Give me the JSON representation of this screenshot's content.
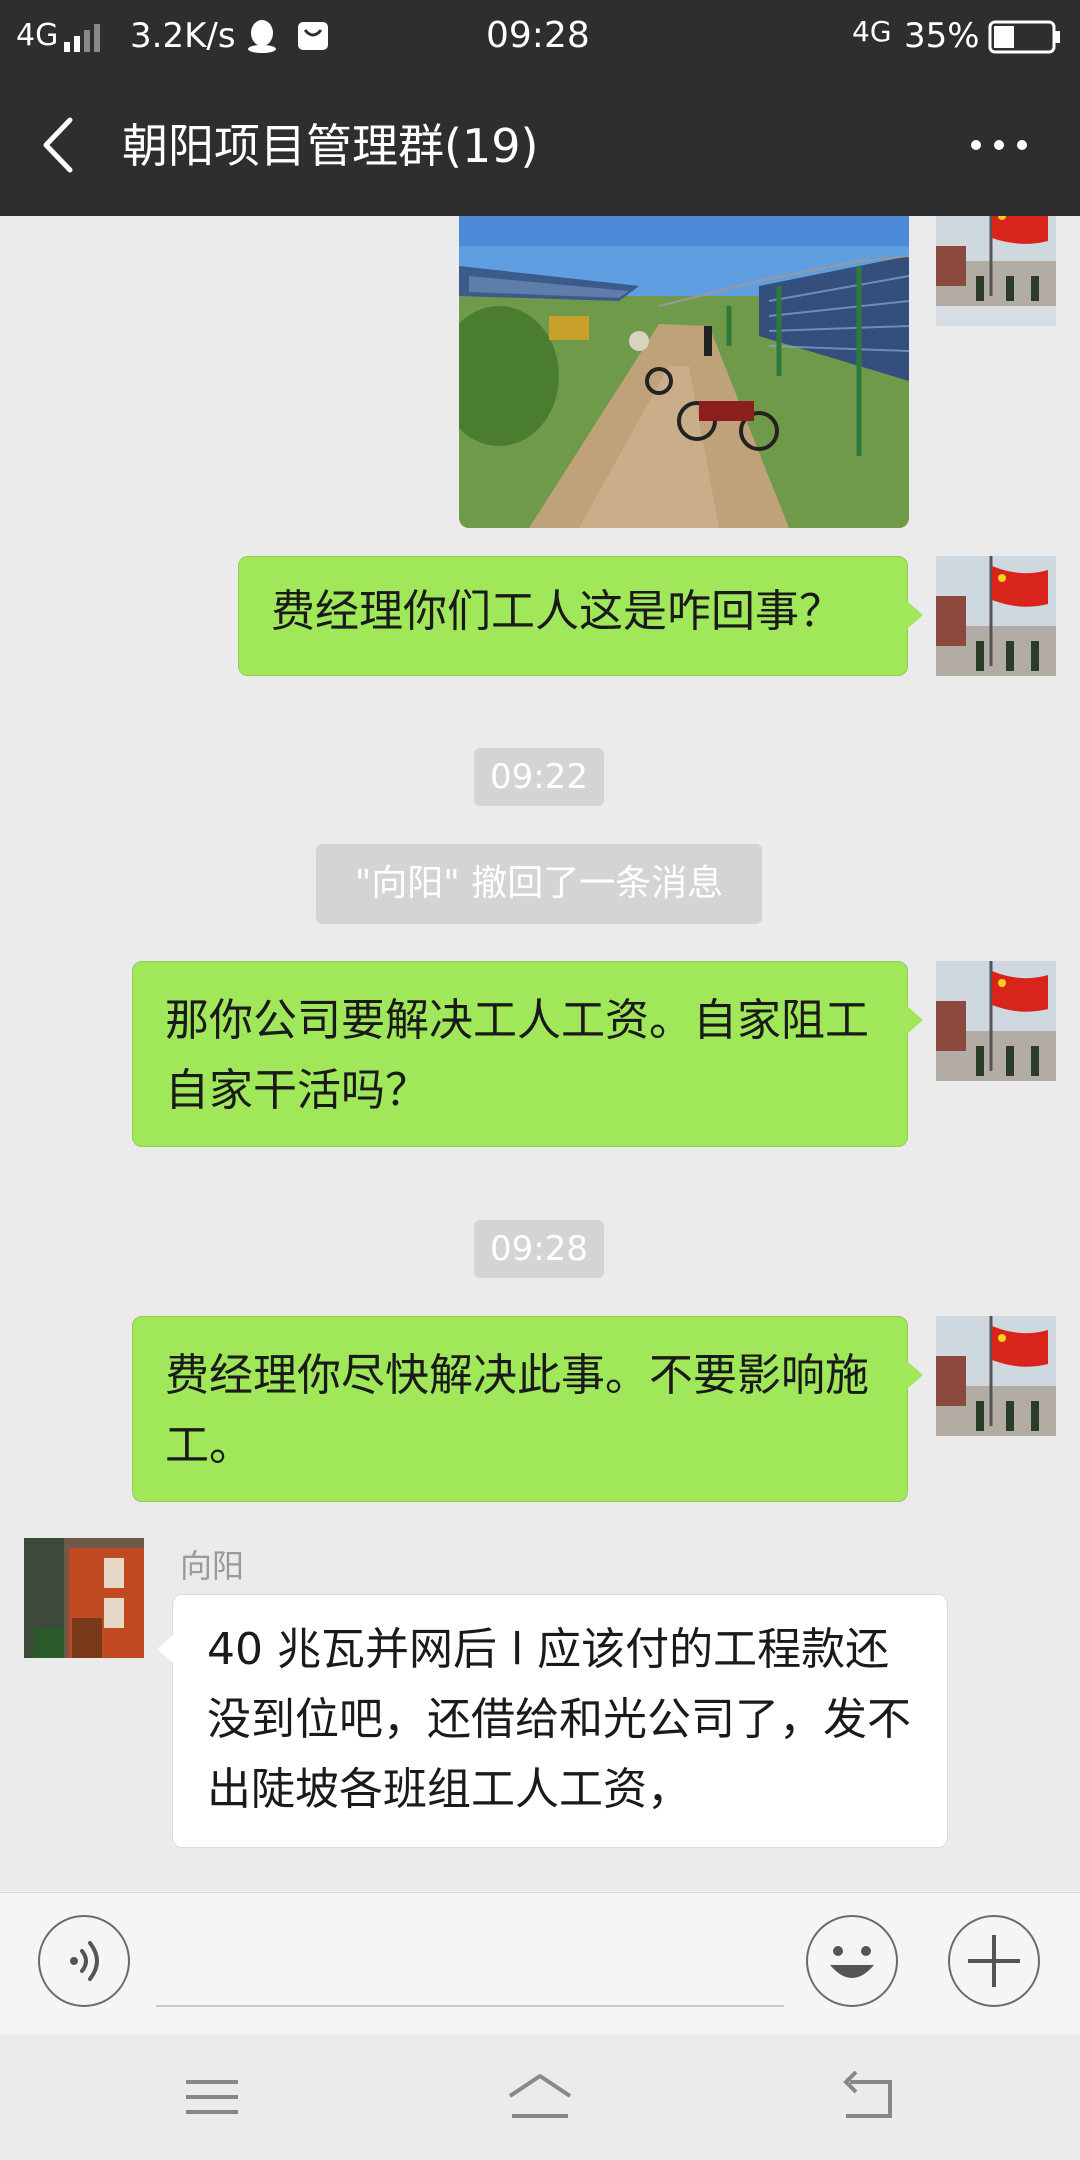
{
  "status_bar": {
    "network_left": "4G",
    "speed": "3.2K/s",
    "time": "09:28",
    "network_right": "4G",
    "battery": "35%"
  },
  "title_bar": {
    "title": "朝阳项目管理群(19)",
    "back_icon": "chevron-left-icon",
    "more_icon": "more-dots-icon"
  },
  "messages": [
    {
      "type": "image",
      "from": "me",
      "content": "solar-farm-photo"
    },
    {
      "type": "text",
      "from": "me",
      "text": "费经理你们工人这是咋回事？"
    },
    {
      "type": "time",
      "text": "09:22"
    },
    {
      "type": "system",
      "text": "\"向阳\" 撤回了一条消息"
    },
    {
      "type": "text",
      "from": "me",
      "text": "那你公司要解决工人工资。自家阻工自家干活吗？"
    },
    {
      "type": "time",
      "text": "09:28"
    },
    {
      "type": "text",
      "from": "me",
      "text": "费经理你尽快解决此事。不要影响施工。"
    },
    {
      "type": "text",
      "from": "other",
      "sender": "向阳",
      "text": "40 兆瓦并网后 l 应该付的工程款还没到位吧，还借给和光公司了，发不出陡坡各班组工人工资，"
    }
  ],
  "input_bar": {
    "voice_icon": "voice-icon",
    "emoji_icon": "emoji-icon",
    "plus_icon": "plus-icon",
    "input_value": ""
  },
  "nav_bar": {
    "menu_icon": "menu-icon",
    "home_icon": "home-icon",
    "back_icon": "return-icon"
  },
  "colors": {
    "header": "#2e2e2e",
    "bubble_me": "#a0e75a",
    "bubble_other": "#ffffff",
    "chat_bg": "#ebebeb"
  }
}
